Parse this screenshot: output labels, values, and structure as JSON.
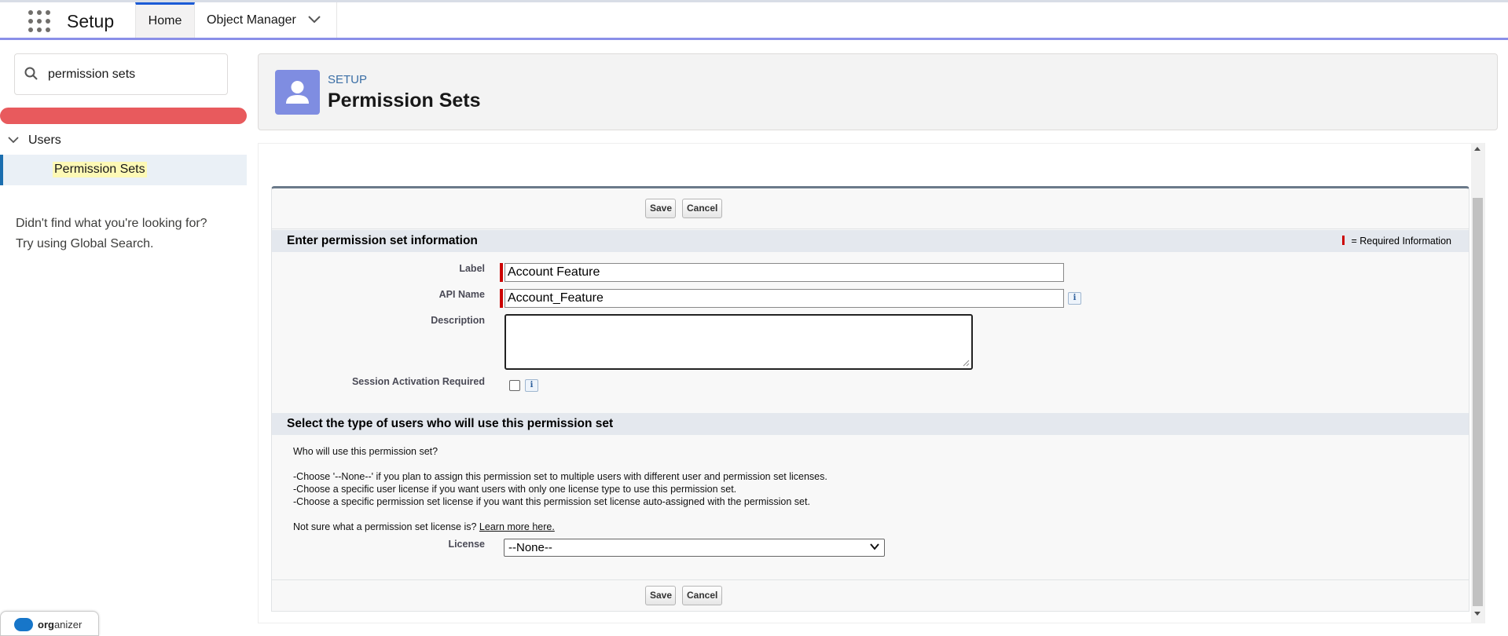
{
  "nav": {
    "app_title": "Setup",
    "tabs": [
      {
        "label": "Home"
      },
      {
        "label": "Object Manager"
      }
    ]
  },
  "sidebar": {
    "search_value": "permission sets",
    "tree": {
      "parent": "Users",
      "child": "Permission Sets"
    },
    "help_line1": "Didn't find what you're looking for?",
    "help_line2": "Try using Global Search."
  },
  "header": {
    "breadcrumb": "SETUP",
    "title": "Permission Sets"
  },
  "form": {
    "save_label": "Save",
    "cancel_label": "Cancel",
    "section1_title": "Enter permission set information",
    "required_legend": "= Required Information",
    "label_label": "Label",
    "label_value": "Account Feature",
    "api_label": "API Name",
    "api_value": "Account_Feature",
    "desc_label": "Description",
    "desc_value": "",
    "session_label": "Session Activation Required",
    "session_checked": false,
    "info_glyph": "i",
    "section2_title": "Select the type of users who will use this permission set",
    "who_text": "Who will use this permission set?",
    "choose1": "-Choose '--None--' if you plan to assign this permission set to multiple users with different user and permission set licenses.",
    "choose2": "-Choose a specific user license if you want users with only one license type to use this permission set.",
    "choose3": "-Choose a specific permission set license if you want this permission set license auto-assigned with the permission set.",
    "not_sure": "Not sure what a permission set license is?",
    "learn_more": "Learn more here.",
    "license_label": "License",
    "license_value": "--None--"
  },
  "organizer": {
    "brand_bold": "org",
    "brand_rest": "anizer"
  },
  "colors": {
    "accent": "#1b5bd6",
    "nav_border": "#8a8fe8",
    "header_icon": "#7f8de1",
    "required": "#cc0000",
    "search_highlight": "#e85a5d"
  }
}
